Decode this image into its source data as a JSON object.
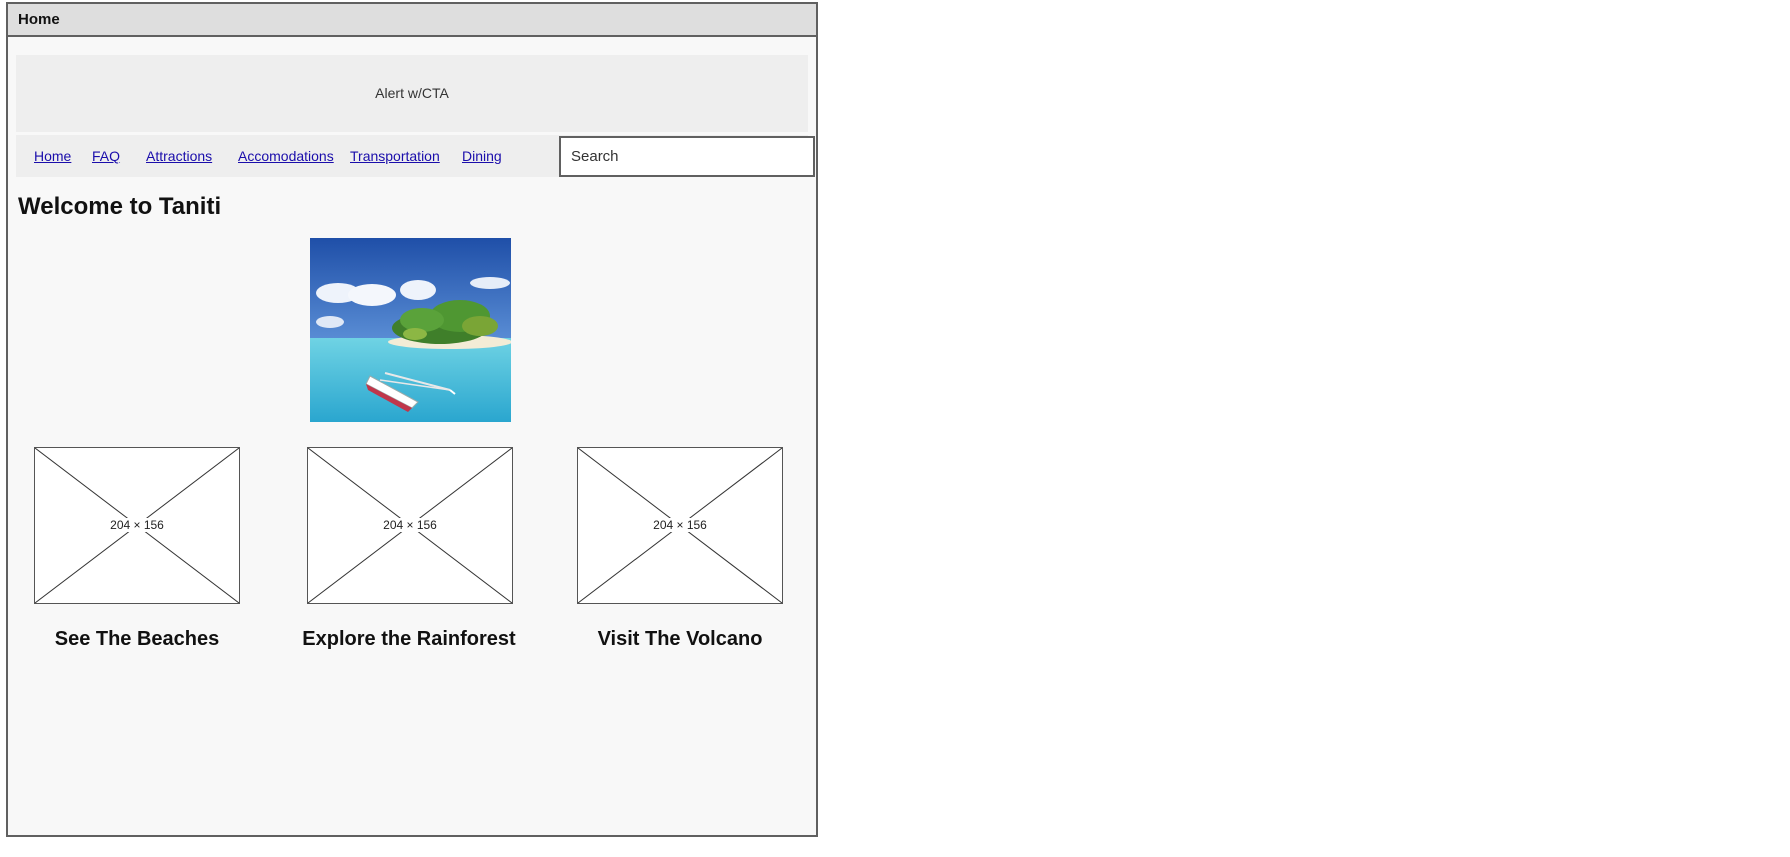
{
  "window": {
    "title": "Home"
  },
  "alert": {
    "text": "Alert w/CTA"
  },
  "nav": {
    "items": [
      {
        "label": "Home"
      },
      {
        "label": "FAQ"
      },
      {
        "label": "Attractions"
      },
      {
        "label": "Accomodations"
      },
      {
        "label": "Transportation"
      },
      {
        "label": "Dining"
      }
    ]
  },
  "search": {
    "placeholder": "Search"
  },
  "main": {
    "heading": "Welcome to Taniti",
    "cards": [
      {
        "image_label": "204 × 156",
        "title": "See The Beaches"
      },
      {
        "image_label": "204 × 156",
        "title": "Explore the Rainforest"
      },
      {
        "image_label": "204 × 156",
        "title": "Visit The Volcano"
      }
    ]
  },
  "colors": {
    "link": "#1a0dab",
    "border": "#606060",
    "titlebar": "#dedede",
    "panel": "#eeeeee"
  }
}
